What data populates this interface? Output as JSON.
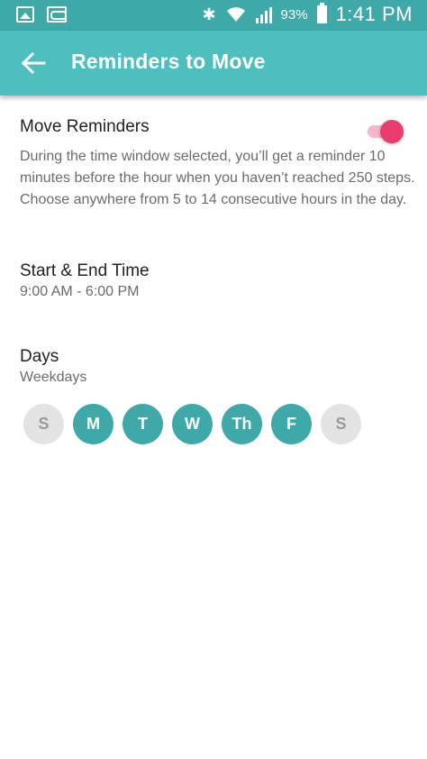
{
  "status_bar": {
    "battery": "93%",
    "time": "1:41 PM"
  },
  "app_bar": {
    "title": "Reminders to Move"
  },
  "move_reminders": {
    "title": "Move Reminders",
    "enabled": true,
    "description": "During the time window selected, you’ll get a reminder 10 minutes before the hour when you haven’t reached 250 steps. Choose anywhere from 5 to 14 consecutive hours in the day."
  },
  "time_window": {
    "title": "Start & End Time",
    "value": "9:00 AM - 6:00 PM"
  },
  "days": {
    "title": "Days",
    "value": "Weekdays",
    "items": [
      {
        "label": "S",
        "selected": false
      },
      {
        "label": "M",
        "selected": true
      },
      {
        "label": "T",
        "selected": true
      },
      {
        "label": "W",
        "selected": true
      },
      {
        "label": "Th",
        "selected": true
      },
      {
        "label": "F",
        "selected": true
      },
      {
        "label": "S",
        "selected": false
      }
    ]
  },
  "colors": {
    "status_bar": "#3fa9a9",
    "app_bar": "#4dbfbf",
    "toggle_on": "#ea3d6d",
    "day_selected": "#3fa9a9",
    "day_unselected": "#e3e3e3"
  },
  "icons": {
    "back": "arrow-left-icon",
    "gallery": "gallery-notification-icon",
    "voicemail": "voicemail-icon",
    "bluetooth": "bluetooth-icon",
    "wifi": "wifi-icon",
    "signal": "cell-signal-icon",
    "battery": "battery-icon"
  }
}
